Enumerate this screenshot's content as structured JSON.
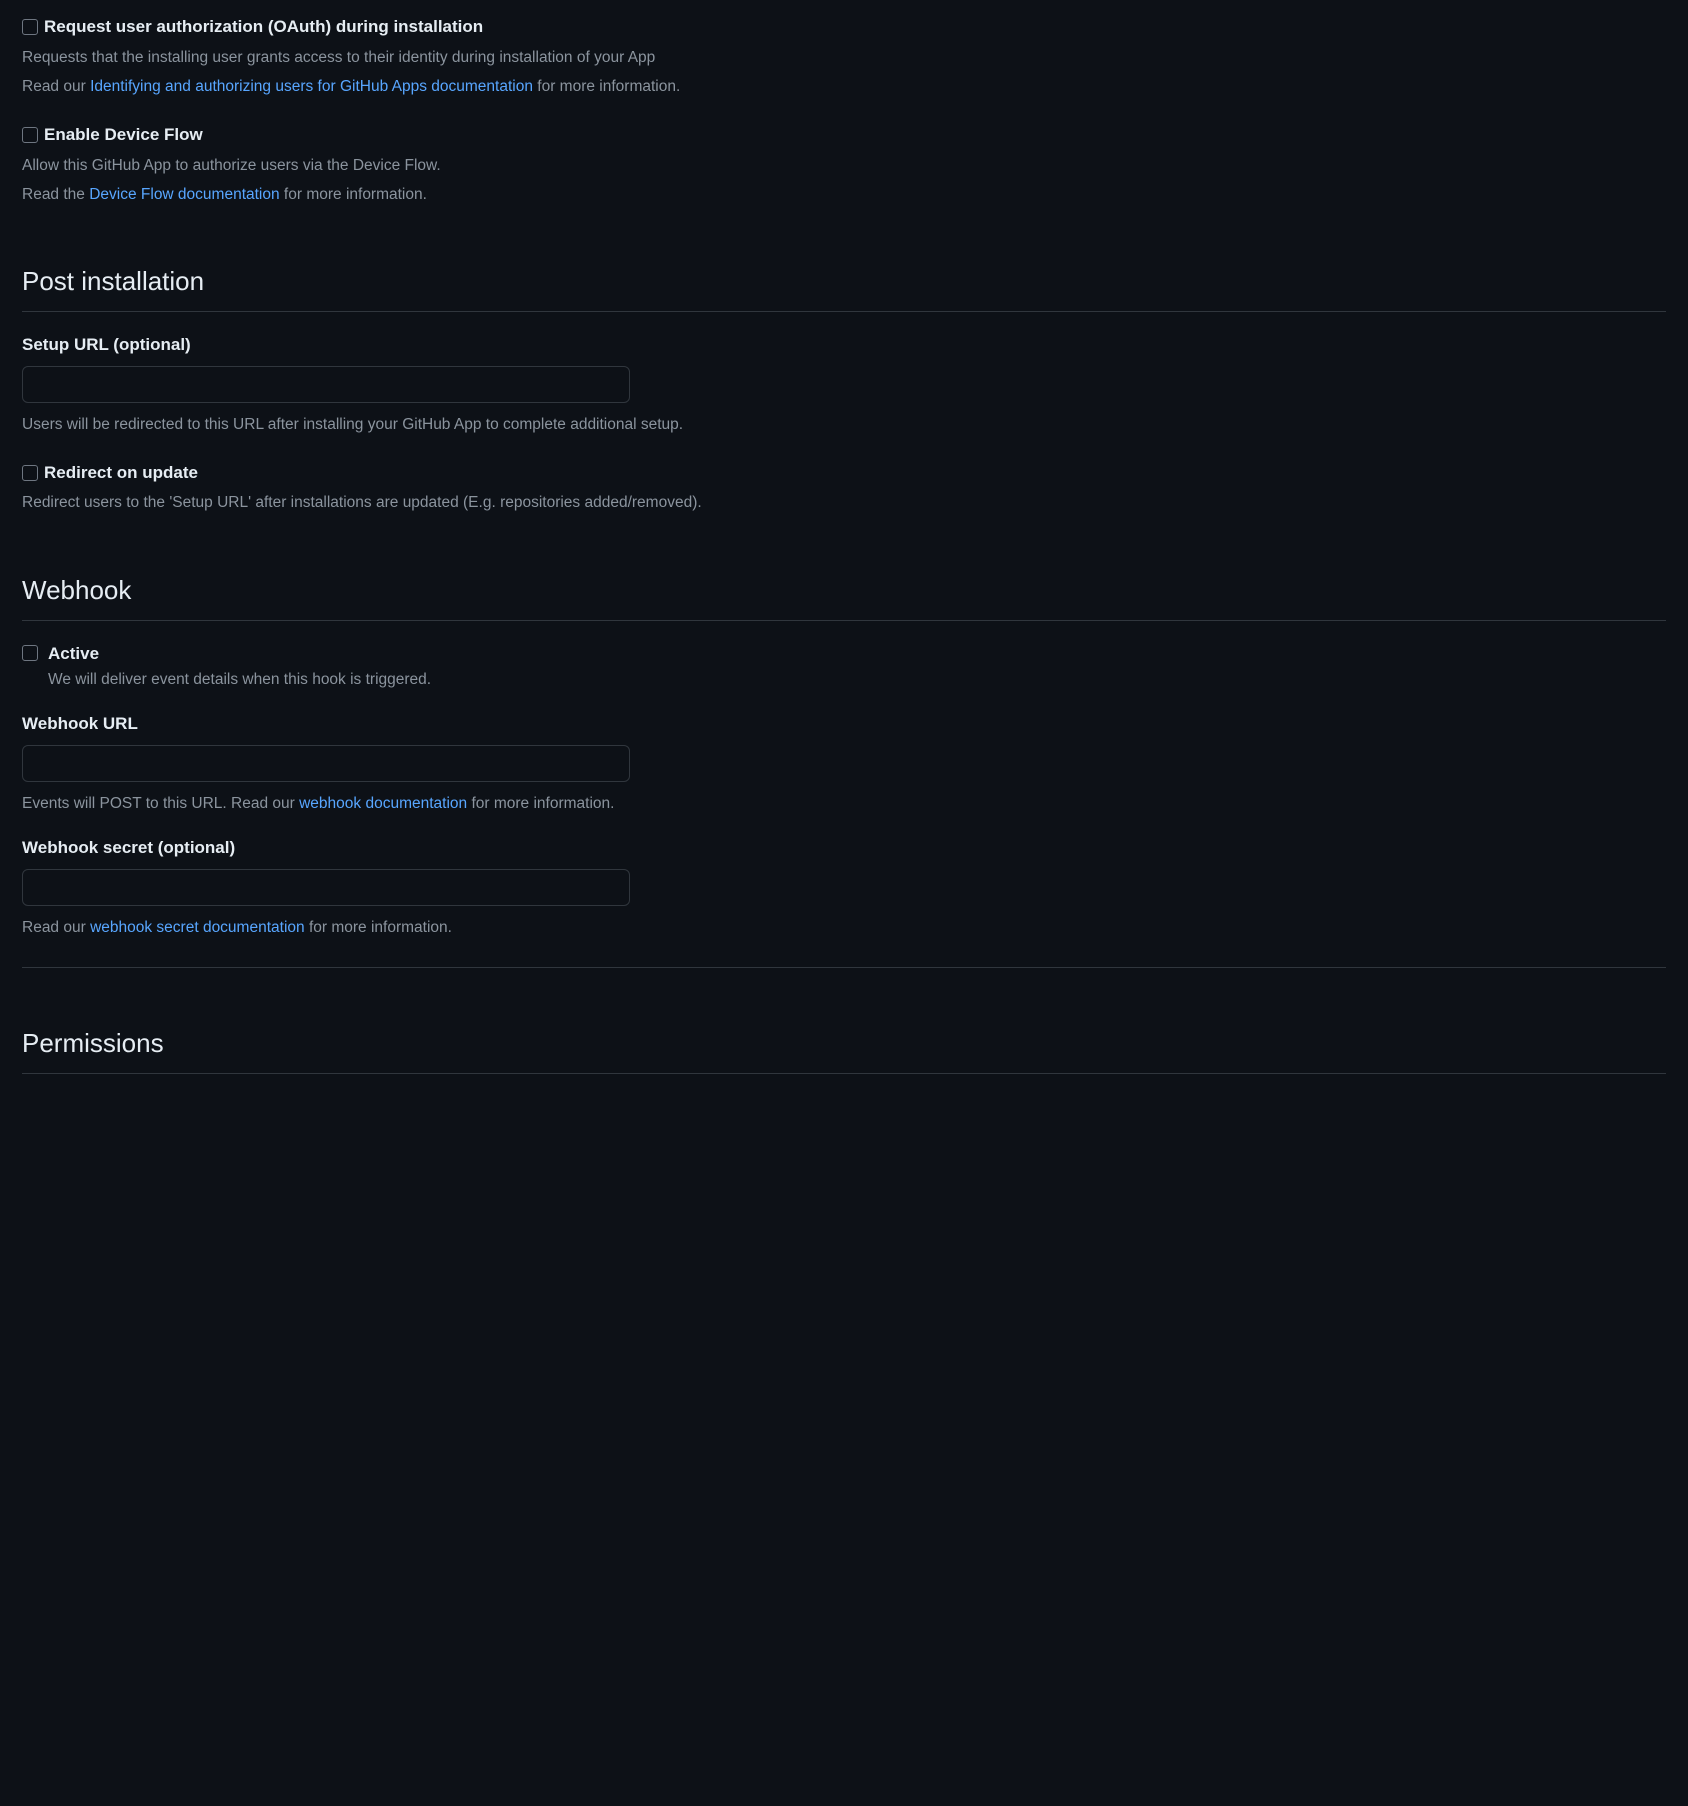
{
  "oauth": {
    "checkbox_label": "Request user authorization (OAuth) during installation",
    "desc": "Requests that the installing user grants access to their identity during installation of your App",
    "read_our": "Read our ",
    "link_text": "Identifying and authorizing users for GitHub Apps documentation",
    "more_info": " for more information."
  },
  "device_flow": {
    "checkbox_label": "Enable Device Flow",
    "desc": "Allow this GitHub App to authorize users via the Device Flow.",
    "read_the": "Read the ",
    "link_text": "Device Flow documentation",
    "more_info": " for more information."
  },
  "post_installation": {
    "heading": "Post installation",
    "setup_url": {
      "label": "Setup URL (optional)",
      "value": "",
      "desc": "Users will be redirected to this URL after installing your GitHub App to complete additional setup."
    },
    "redirect_on_update": {
      "checkbox_label": "Redirect on update",
      "desc": "Redirect users to the 'Setup URL' after installations are updated (E.g. repositories added/removed)."
    }
  },
  "webhook": {
    "heading": "Webhook",
    "active": {
      "checkbox_label": "Active",
      "desc": "We will deliver event details when this hook is triggered."
    },
    "url": {
      "label": "Webhook URL",
      "value": "",
      "desc_prefix": "Events will POST to this URL. Read our ",
      "link_text": "webhook documentation",
      "desc_suffix": " for more information."
    },
    "secret": {
      "label": "Webhook secret (optional)",
      "value": "",
      "desc_prefix": "Read our ",
      "link_text": "webhook secret documentation",
      "desc_suffix": " for more information."
    }
  },
  "permissions": {
    "heading": "Permissions"
  }
}
